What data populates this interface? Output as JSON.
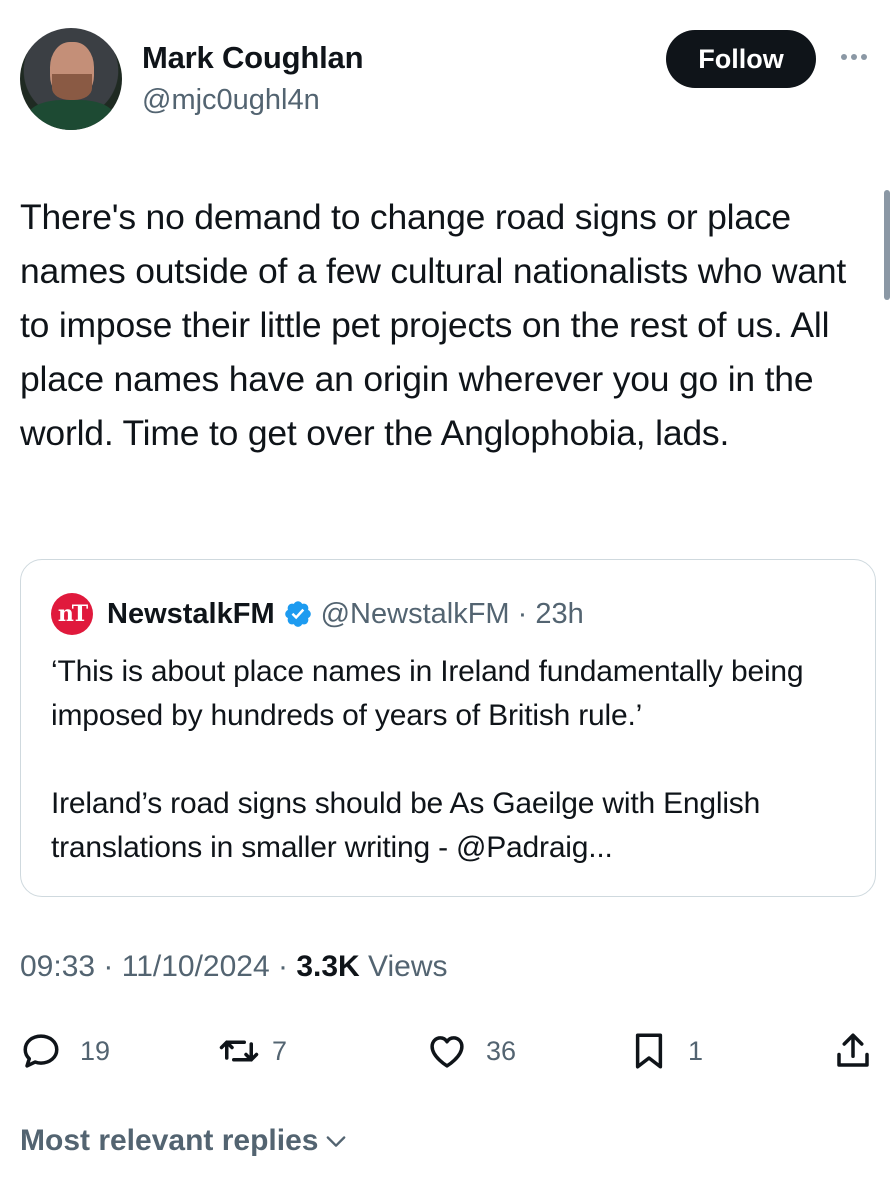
{
  "author": {
    "name": "Mark Coughlan",
    "handle": "@mjc0ughl4n"
  },
  "follow_label": "Follow",
  "tweet_text": "There's no demand to change road signs or place names outside of a few cultural nationalists who want to impose their little pet projects on the rest of us. All place names have an origin wherever you go in the world. Time to get over the Anglophobia, lads.",
  "quote": {
    "logo_text": "nT",
    "name": "NewstalkFM",
    "handle_time": "@NewstalkFM · 23h",
    "text": "‘This is about place names in Ireland fundamentally being imposed by hundreds of years of British rule.’\n\nIreland’s road signs should be As Gaeilge with English translations in smaller writing - @Padraig..."
  },
  "meta": {
    "time_date": "09:33 · 11/10/2024 · ",
    "views_count": "3.3K",
    "views_label": " Views"
  },
  "actions": {
    "replies": "19",
    "reposts": "7",
    "likes": "36",
    "bookmarks": "1"
  },
  "most_relevant_label": "Most relevant replies",
  "colors": {
    "text": "#0f1419",
    "secondary": "#536471",
    "verified": "#1d9bf0",
    "logo": "#e0193c",
    "border": "#cfd9de"
  },
  "icons": [
    "reply-icon",
    "repost-icon",
    "like-icon",
    "bookmark-icon",
    "share-icon",
    "verified-badge-icon",
    "more-icon",
    "chevron-down-icon"
  ]
}
